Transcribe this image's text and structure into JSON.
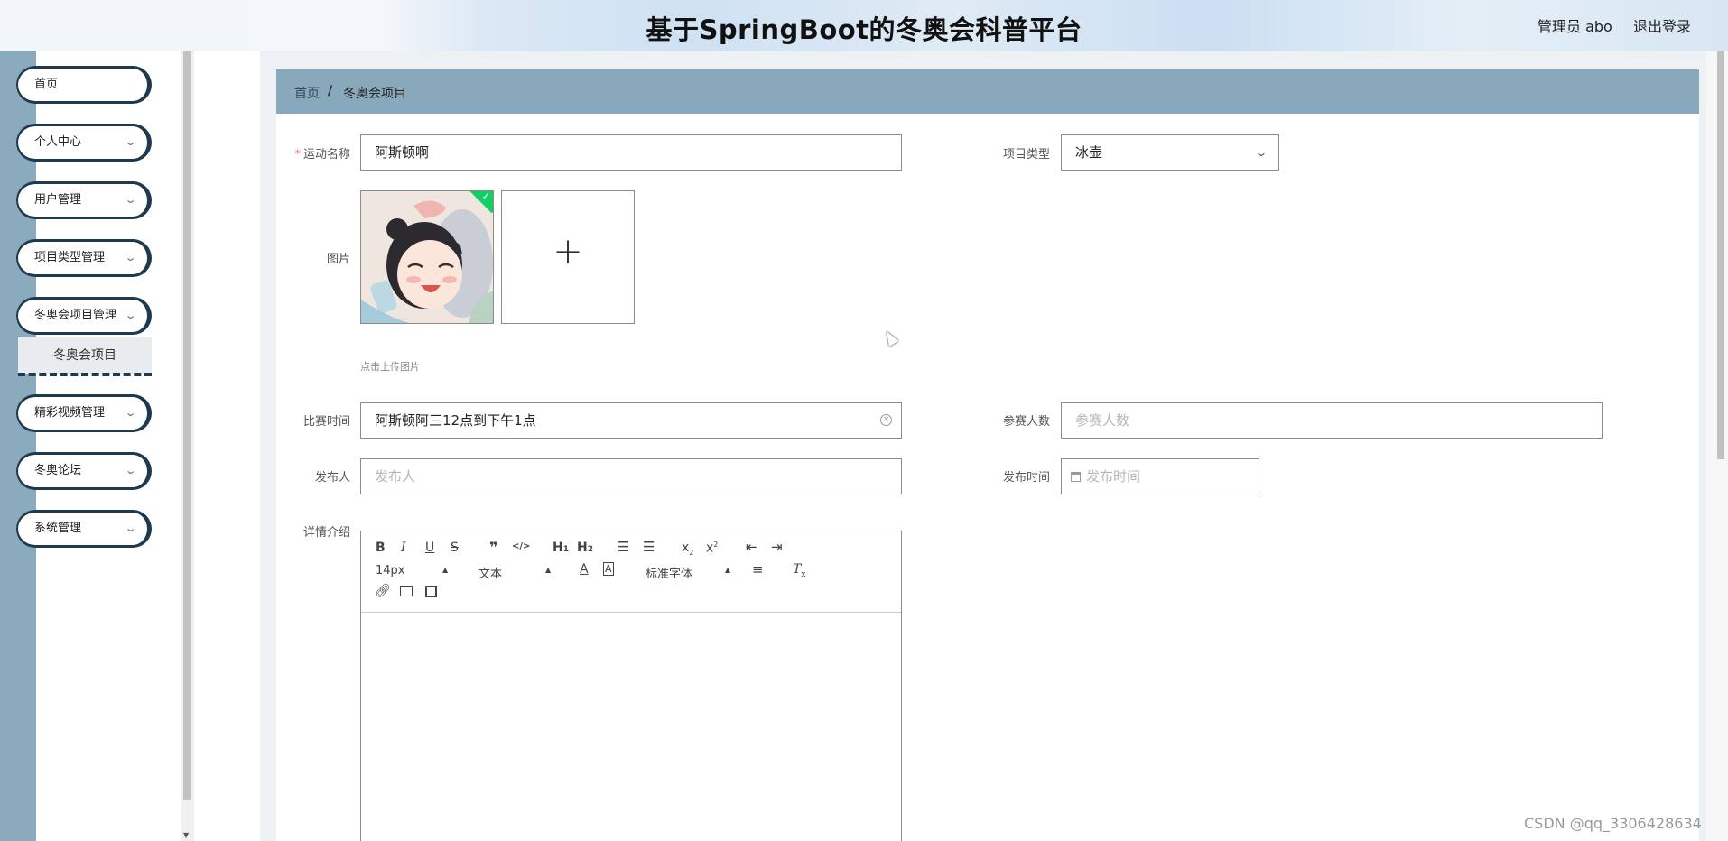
{
  "header": {
    "title": "基于SpringBoot的冬奥会科普平台",
    "user": "管理员 abo",
    "logout": "退出登录"
  },
  "sidebar": {
    "items": [
      {
        "label": "首页",
        "has_children": false
      },
      {
        "label": "个人中心",
        "has_children": true
      },
      {
        "label": "用户管理",
        "has_children": true
      },
      {
        "label": "项目类型管理",
        "has_children": true
      },
      {
        "label": "冬奥会项目管理",
        "has_children": true,
        "expanded": true
      },
      {
        "label": "精彩视频管理",
        "has_children": true
      },
      {
        "label": "冬奥论坛",
        "has_children": true
      },
      {
        "label": "系统管理",
        "has_children": true
      }
    ],
    "submenu": {
      "label": "冬奥会项目"
    }
  },
  "breadcrumb": {
    "home": "首页",
    "separator": "/",
    "current": "冬奥会项目"
  },
  "form": {
    "name": {
      "label": "运动名称",
      "required": true,
      "value": "阿斯顿啊"
    },
    "type": {
      "label": "项目类型",
      "value": "冰壶"
    },
    "image": {
      "label": "图片",
      "tip": "点击上传图片"
    },
    "match_time": {
      "label": "比赛时间",
      "value": "阿斯顿阿三12点到下午1点"
    },
    "participants": {
      "label": "参赛人数",
      "placeholder": "参赛人数"
    },
    "publisher": {
      "label": "发布人",
      "placeholder": "发布人"
    },
    "publish_time": {
      "label": "发布时间",
      "placeholder": "发布时间"
    },
    "details": {
      "label": "详情介绍"
    }
  },
  "editor": {
    "font_size": "14px",
    "text_style": "文本",
    "font_family": "标准字体",
    "buttons": {
      "bold": "B",
      "italic": "I",
      "underline": "U",
      "strike": "S",
      "quote": "❞",
      "code": "</>",
      "h1": "H",
      "h1_sub": "1",
      "h2": "H",
      "h2_sub": "2",
      "sub": "x",
      "sub_mark": "2",
      "sup": "x",
      "sup_mark": "2",
      "color": "A",
      "background": "A",
      "clean": "T",
      "clean_sub": "x"
    }
  },
  "watermark": "CSDN @qq_3306428634",
  "colors": {
    "accent": "#88a9bb",
    "menu_border": "#1e3a4f",
    "success": "#13ce66"
  }
}
